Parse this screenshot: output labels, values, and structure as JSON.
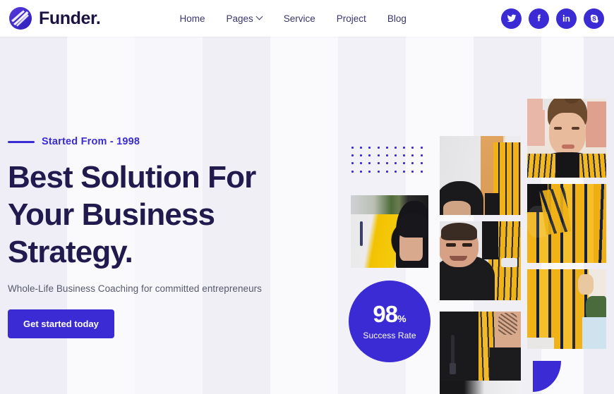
{
  "header": {
    "brand": "Funder.",
    "logo_icon": "funder-circle-logo",
    "nav": [
      {
        "label": "Home",
        "has_dropdown": false
      },
      {
        "label": "Pages",
        "has_dropdown": true
      },
      {
        "label": "Service",
        "has_dropdown": false
      },
      {
        "label": "Project",
        "has_dropdown": false
      },
      {
        "label": "Blog",
        "has_dropdown": false
      }
    ],
    "socials": [
      {
        "name": "twitter-icon",
        "title": "Twitter"
      },
      {
        "name": "facebook-icon",
        "title": "Facebook"
      },
      {
        "name": "linkedin-icon",
        "title": "LinkedIn"
      },
      {
        "name": "skype-icon",
        "title": "Skype"
      }
    ]
  },
  "hero": {
    "eyebrow": "Started From - 1998",
    "headline_line1": "Best Solution For",
    "headline_line2": "Your Business",
    "headline_line3": "Strategy.",
    "subline": "Whole-Life Business Coaching for committed entrepreneurs",
    "cta_label": "Get started today"
  },
  "stats": {
    "value": "98",
    "unit": "%",
    "label": "Success Rate"
  },
  "decor": {
    "dot_columns": 9,
    "dot_rows": 4,
    "leaf_shape": "quarter-circle"
  },
  "gallery": [
    {
      "id": "photo-man-hat-yellow",
      "alt": "Man in black hat beside yellow wall"
    },
    {
      "id": "photo-man-beanie",
      "alt": "Man in black beanie near plaid jacket"
    },
    {
      "id": "photo-man-smiling",
      "alt": "Smiling man in black t-shirt"
    },
    {
      "id": "photo-man-tattoo",
      "alt": "Man with tattooed arm in black shirt"
    },
    {
      "id": "photo-woman-portrait",
      "alt": "Smiling woman with bun in plaid jacket"
    },
    {
      "id": "photo-plaid-jacket",
      "alt": "Close up of yellow plaid jacket"
    },
    {
      "id": "photo-plaid-detail",
      "alt": "Yellow plaid jacket detail"
    }
  ],
  "colors": {
    "accent": "#3a2bd4",
    "headline": "#211a4e",
    "nav_text": "#3b3670",
    "body_text": "#55596b",
    "bg_light": "#fafafc",
    "bg_lavender": "#eeedf5"
  }
}
